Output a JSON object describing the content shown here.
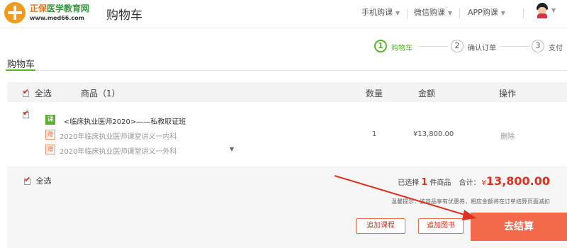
{
  "header": {
    "logo_name_a": "正保",
    "logo_name_b": "医学教育网",
    "logo_url": "www.med66.com",
    "page_title": "购物车",
    "nav": [
      "手机购课",
      "微信购课",
      "APP购课"
    ],
    "colors": {
      "brand_green": "#5bb32d",
      "brand_orange": "#f19a1d",
      "accent_red": "#e0301e"
    }
  },
  "steps": [
    {
      "num": "1",
      "label": "购物车",
      "active": true
    },
    {
      "num": "2",
      "label": "确认订单",
      "active": false
    },
    {
      "num": "3",
      "label": "支付",
      "active": false
    }
  ],
  "section_title": "购物车",
  "table": {
    "select_all": "全选",
    "col_product": "商品（1）",
    "col_qty": "数量",
    "col_amount": "金额",
    "col_action": "操作"
  },
  "items": [
    {
      "tag": "课",
      "title": "<临床执业医师2020>——私教取证班",
      "gifts": [
        {
          "tag": "赠",
          "text": "2020年临床执业医师课堂讲义一内科"
        },
        {
          "tag": "赠",
          "text": "2020年临床执业医师课堂讲义一外科"
        }
      ],
      "qty": "1",
      "amount": "¥13,800.00",
      "action": "删除",
      "checked": true
    }
  ],
  "footer": {
    "select_all": "全选",
    "selected_prefix": "已选择",
    "selected_count": "1",
    "selected_suffix": "件商品",
    "total_label": "合计：",
    "currency": "¥",
    "total": "13,800.00",
    "notice": "温馨提示：该商品享有优惠券，相应金额将在订单结算页面减扣",
    "add_course": "追加课程",
    "add_book": "追加图书",
    "checkout": "去结算"
  }
}
